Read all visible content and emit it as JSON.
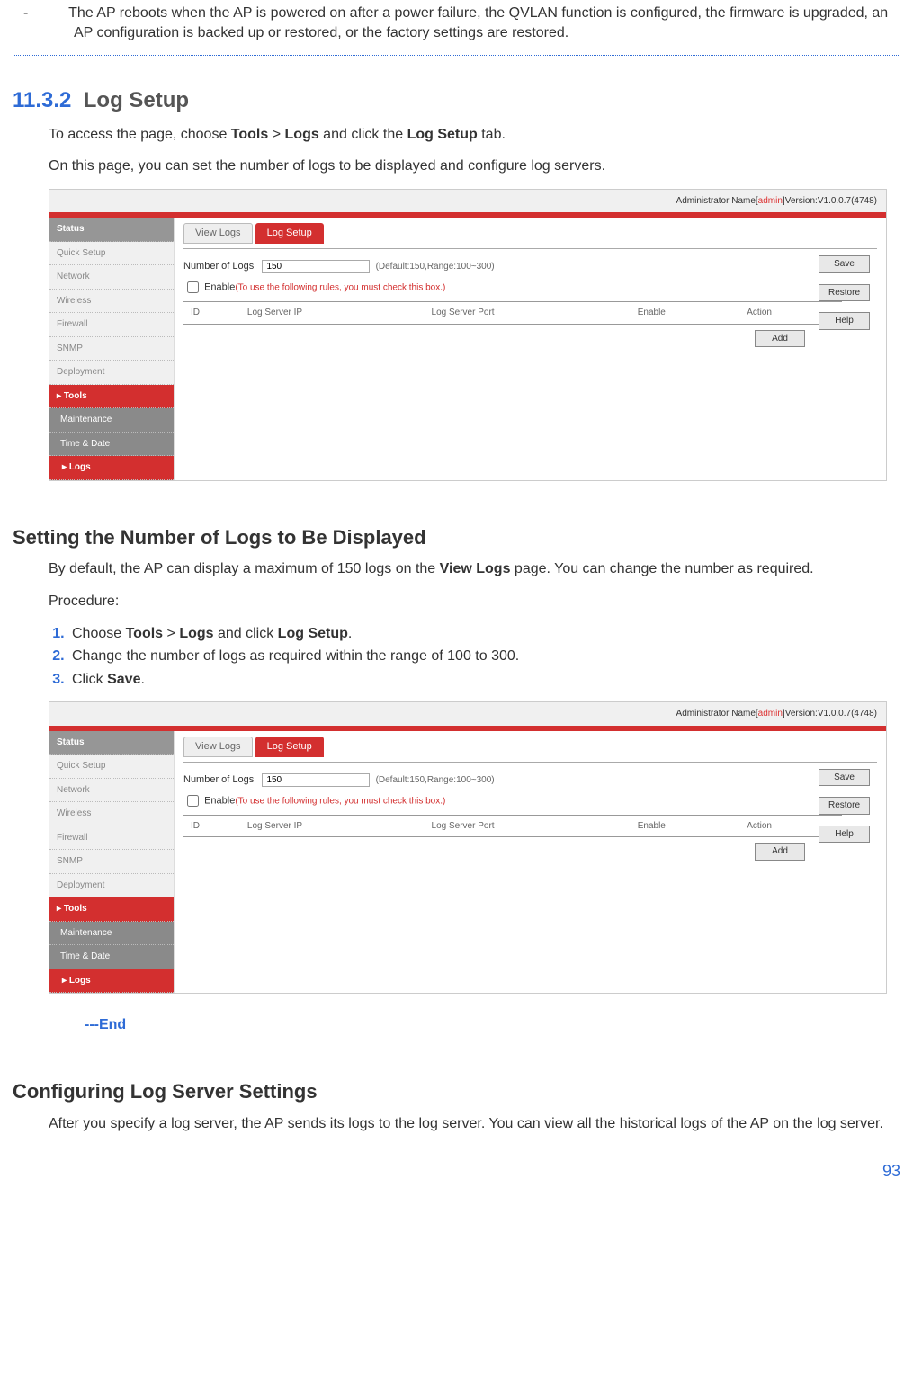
{
  "top_note": "The AP reboots when the AP is powered on after a power failure, the QVLAN function is configured, the firmware is upgraded, an AP configuration is backed up or restored, or the factory settings are restored.",
  "sec_num": "11.3.2",
  "sec_title": "Log Setup",
  "intro1_a": "To access the page, choose ",
  "intro1_b": "Tools",
  "intro1_c": " > ",
  "intro1_d": "Logs",
  "intro1_e": " and click the ",
  "intro1_f": "Log Setup",
  "intro1_g": " tab.",
  "intro2": "On this page, you can set the number of logs to be displayed and configure log servers.",
  "sub1": "Setting the Number of Logs to Be Displayed",
  "sub1_p1_a": "By default, the AP can display a maximum of 150 logs on the ",
  "sub1_p1_b": "View Logs",
  "sub1_p1_c": " page. You can change the number as required.",
  "proc": "Procedure:",
  "step1_a": "Choose ",
  "step1_b": "Tools",
  "step1_c": " > ",
  "step1_d": "Logs",
  "step1_e": " and click ",
  "step1_f": "Log Setup",
  "step1_g": ".",
  "step2": "Change the number of logs as required within the range of 100 to 300.",
  "step3_a": "Click ",
  "step3_b": "Save",
  "step3_c": ".",
  "end": "---End",
  "sub2": "Configuring Log Server Settings",
  "sub2_p1": "After you specify a log server, the AP sends its logs to the log server. You can view all the historical logs of the AP on the log server.",
  "page_number": "93",
  "shot": {
    "admin_prefix": "Administrator Name[",
    "admin_name": "admin",
    "admin_suffix": "]Version:V1.0.0.7(4748)",
    "nav": {
      "status": "Status",
      "quick_setup": "Quick Setup",
      "network": "Network",
      "wireless": "Wireless",
      "firewall": "Firewall",
      "snmp": "SNMP",
      "deployment": "Deployment",
      "tools": "Tools",
      "maintenance": "Maintenance",
      "time_date": "Time & Date",
      "logs": "Logs"
    },
    "tabs": {
      "view": "View Logs",
      "setup": "Log Setup"
    },
    "num_label": "Number of Logs",
    "num_value": "150",
    "num_hint": "(Default:150,Range:100~300)",
    "enable_label": "Enable",
    "enable_hint": "(To use the following rules, you must check this box.)",
    "th": {
      "id": "ID",
      "ip": "Log Server IP",
      "port": "Log Server Port",
      "enable": "Enable",
      "action": "Action"
    },
    "btn": {
      "save": "Save",
      "restore": "Restore",
      "help": "Help",
      "add": "Add"
    }
  }
}
